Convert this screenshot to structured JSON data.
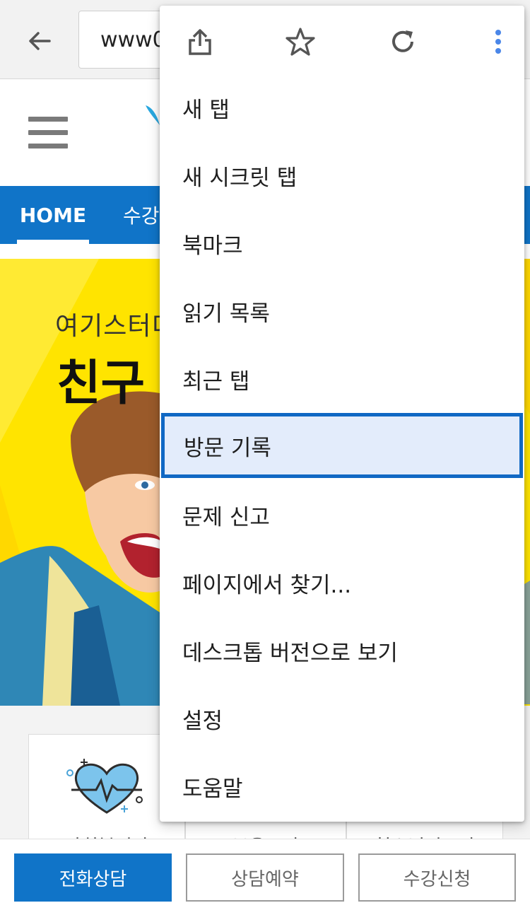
{
  "browser": {
    "url_text": "www0"
  },
  "site": {
    "nav": {
      "home_label": "HOME",
      "second_label": "수강"
    },
    "banner": {
      "subtitle": "여기스터디",
      "title": "친구"
    },
    "cards": [
      {
        "label": "사회복지사"
      },
      {
        "label": "보육교사"
      },
      {
        "label": "청소년지도사"
      }
    ]
  },
  "bottom_bar": {
    "call_label": "전화상담",
    "reserve_label": "상담예약",
    "enroll_label": "수강신청"
  },
  "menu": {
    "top_icons": [
      "share-icon",
      "star-icon",
      "refresh-icon",
      "more-vert-icon"
    ],
    "items": [
      {
        "label": "새 탭"
      },
      {
        "label": "새 시크릿 탭"
      },
      {
        "label": "북마크"
      },
      {
        "label": "읽기 목록"
      },
      {
        "label": "최근 탭"
      },
      {
        "label": "방문 기록",
        "selected": true
      },
      {
        "label": "문제 신고"
      },
      {
        "label": "페이지에서 찾기..."
      },
      {
        "label": "데스크톱 버전으로 보기"
      },
      {
        "label": "설정"
      },
      {
        "label": "도움말"
      }
    ]
  },
  "colors": {
    "brand_blue": "#1074c8",
    "banner_yellow": "#ffe400",
    "menu_selected_bg": "#e3ecfb",
    "menu_selected_border": "#1068c4",
    "icon_gray": "#555555",
    "more_blue": "#4a86e8"
  }
}
